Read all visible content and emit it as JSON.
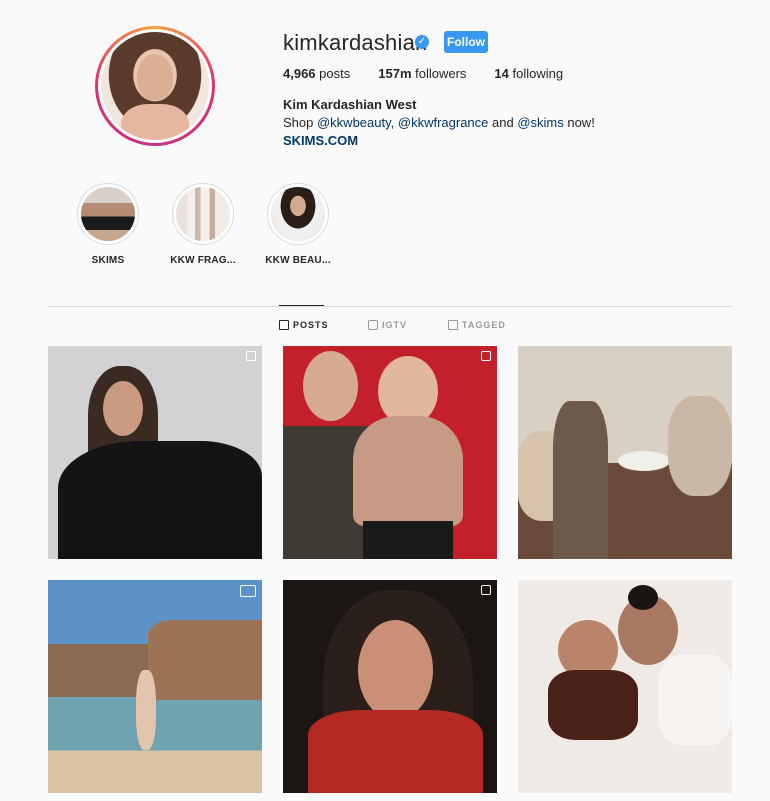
{
  "profile": {
    "username": "kimkardashian",
    "verified_glyph": "✓",
    "follow_label": "Follow",
    "posts_count": "4,966",
    "posts_label": "posts",
    "followers_count": "157m",
    "followers_label": "followers",
    "following_count": "14",
    "following_label": "following",
    "full_name": "Kim Kardashian West",
    "bio_prefix": "Shop ",
    "bio_link1": "@kkwbeauty",
    "bio_sep1": ", ",
    "bio_link2": "@kkwfragrance",
    "bio_sep2": " and ",
    "bio_link3": "@skims",
    "bio_suffix": " now!",
    "website": "SKIMS.COM"
  },
  "highlights": [
    {
      "label": "SKIMS"
    },
    {
      "label": "KKW FRAG..."
    },
    {
      "label": "KKW BEAU..."
    }
  ],
  "tabs": [
    {
      "label": "POSTS",
      "icon": "grid-icon"
    },
    {
      "label": "IGTV",
      "icon": "igtv-icon"
    },
    {
      "label": "TAGGED",
      "icon": "tagged-icon"
    }
  ],
  "colors": {
    "accent": "#3897f0",
    "link": "#00376b",
    "background": "#fafafa"
  }
}
